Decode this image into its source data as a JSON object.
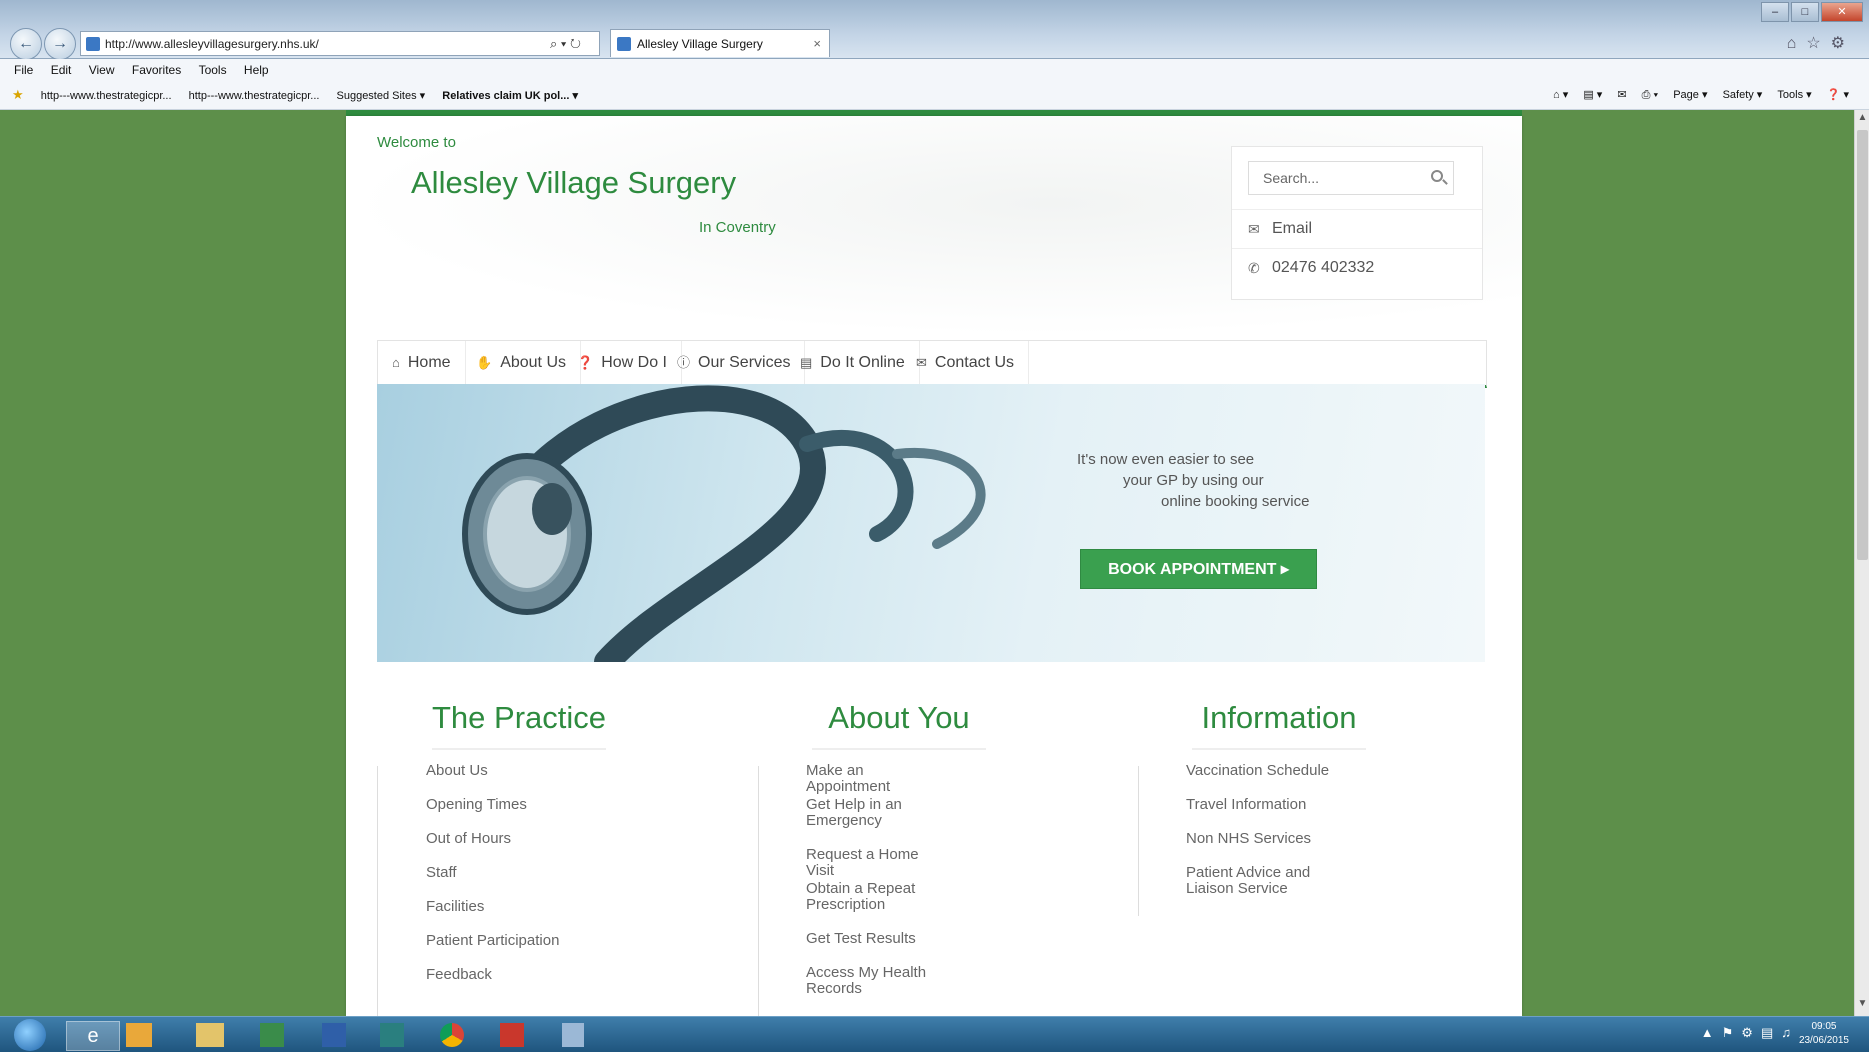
{
  "browser": {
    "url": "http://www.allesleyvillagesurgery.nhs.uk/",
    "addr_tools": "⌕ ▾ ↻",
    "tab_title": "Allesley Village Surgery",
    "menu": [
      "File",
      "Edit",
      "View",
      "Favorites",
      "Tools",
      "Help"
    ],
    "favorites": [
      "http---www.thestrategicpr...",
      "http---www.thestrategicpr...",
      "Suggested Sites ▾",
      "Relatives claim UK pol... ▾"
    ],
    "command_bar": [
      "Page ▾",
      "Safety ▾",
      "Tools ▾"
    ]
  },
  "site": {
    "welcome": "Welcome to",
    "title": "Allesley Village Surgery",
    "subtitle": "In Coventry",
    "search_placeholder": "Search...",
    "email_label": "Email",
    "phone": "02476 402332",
    "nav": [
      {
        "label": "Home",
        "icon": "home-icon"
      },
      {
        "label": "About Us",
        "icon": "thumbs-up-icon"
      },
      {
        "label": "How Do I",
        "icon": "question-icon"
      },
      {
        "label": "Our Services",
        "icon": "info-icon"
      },
      {
        "label": "Do It Online",
        "icon": "monitor-icon"
      },
      {
        "label": "Contact Us",
        "icon": "envelope-icon"
      }
    ],
    "banner": {
      "lines": [
        "It's now even easier to see",
        "your GP by using our",
        "online booking service"
      ],
      "button": "BOOK APPOINTMENT ▸"
    },
    "columns": [
      {
        "title": "The Practice",
        "links": [
          "About Us",
          "Opening Times",
          "Out of Hours",
          "Staff",
          "Facilities",
          "Patient Participation",
          "Feedback"
        ]
      },
      {
        "title": "About You",
        "links": [
          "Make an Appointment",
          "Get Help in an Emergency",
          "Request a Home Visit",
          "Obtain a Repeat Prescription",
          "Get Test Results",
          "Access My Health Records"
        ]
      },
      {
        "title": "Information",
        "links": [
          "Vaccination Schedule",
          "Travel Information",
          "Non NHS Services",
          "Patient Advice and Liaison Service"
        ]
      }
    ]
  },
  "taskbar": {
    "time": "09:05",
    "date": "23/06/2015"
  },
  "colors": {
    "brand_green": "#2e8b3f",
    "page_background": "#5d8f4a",
    "button_green": "#3aa04f"
  }
}
